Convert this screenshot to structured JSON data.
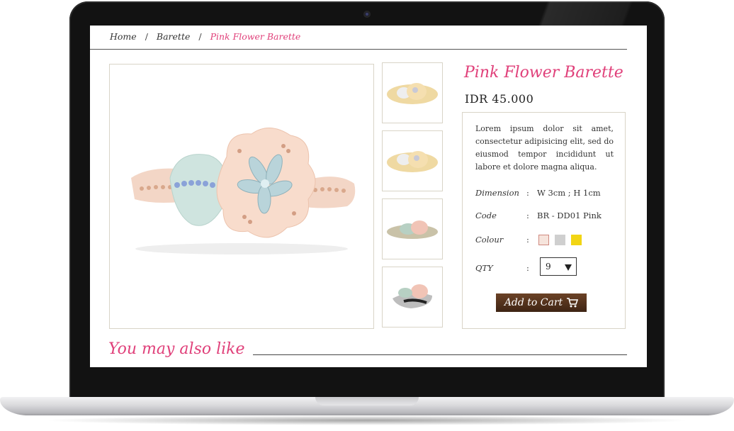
{
  "breadcrumb": {
    "home": "Home",
    "category": "Barette",
    "current": "Pink Flower Barette",
    "separator": "/"
  },
  "product": {
    "title": "Pink Flower Barette",
    "price": "IDR 45.000",
    "description": "Lorem ipsum dolor sit amet, consectetur adipisicing elit, sed do eiusmod tempor incididunt ut labore et dolore magna aliqua.",
    "dimension_label": "Dimension",
    "dimension_value": "W 3cm ; H 1cm",
    "code_label": "Code",
    "code_value": "BR - DD01 Pink",
    "colour_label": "Colour",
    "colours": [
      "#f6e4dc",
      "#cfcfcf",
      "#f2d514"
    ],
    "qty_label": "QTY",
    "qty_value": "9",
    "colon": ":",
    "add_to_cart": "Add to Cart"
  },
  "related": {
    "title": "You may also like"
  },
  "colors": {
    "accent_pink": "#e0407a",
    "button_brown": "#5a3620"
  }
}
